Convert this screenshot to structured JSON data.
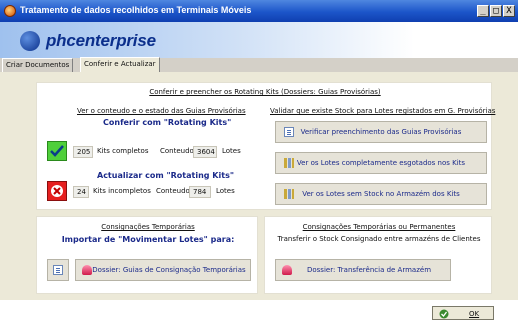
{
  "window": {
    "title": "Tratamento de dados recolhidos em Terminais Móveis",
    "buttons": {
      "minimize": "_",
      "maximize": "□",
      "close": "X"
    }
  },
  "brand": {
    "logo_text": "phcenterprise"
  },
  "tabs": [
    {
      "label": "Criar Documentos"
    },
    {
      "label": "Conferir e Actualizar",
      "selected": true
    }
  ],
  "conferir": {
    "heading": "Conferir e preencher os Rotating Kits (Dossiers: Guias Provisórias)",
    "left_subheading": "Ver o conteudo e o estado das Guias Provisórias",
    "right_subheading": "Validar que existe Stock para Lotes registados em G. Provisórias",
    "conferir_title": "Conferir com \"Rotating Kits\"",
    "kits_completos_value": "205",
    "kits_completos_label": "Kits completos",
    "conteudo_label_1": "Conteudo",
    "conteudo_value_1": "3604",
    "lotes_label_1": "Lotes",
    "actualizar_title": "Actualizar com \"Rotating Kits\"",
    "kits_incompletos_value": "24",
    "kits_incompletos_label": "Kits incompletos",
    "conteudo_label_2": "Conteudo",
    "conteudo_value_2": "784",
    "lotes_label_2": "Lotes",
    "btn_verificar": "Verificar preenchimento das Guias Provisórias",
    "btn_esgotados": "Ver os Lotes completamente esgotados nos Kits",
    "btn_sem_stock": "Ver os Lotes sem Stock no Armazém dos Kits"
  },
  "consignacoes_temp": {
    "heading": "Consignações Temporárias",
    "subheading": "Importar de \"Movimentar Lotes\" para:",
    "btn_dossier": "Dossier: Guias de Consignação Temporárias"
  },
  "consignacoes_perm": {
    "heading": "Consignações Temporárias ou Permanentes",
    "subheading": "Transferir o Stock Consignado entre armazéns de Clientes",
    "btn_dossier": "Dossier: Transferência de Armazém"
  },
  "ok_button": {
    "label": "OK"
  },
  "colors": {
    "titlebar": "#1c55c9",
    "accent_navy": "#1b2a8a",
    "check_green": "#4fcf3b",
    "x_red": "#e62020"
  },
  "icons": {
    "app": "app-icon",
    "check": "check-icon",
    "cross": "x-icon",
    "document": "document-icon",
    "bars": "bars-icon",
    "stamp": "stamp-icon"
  }
}
